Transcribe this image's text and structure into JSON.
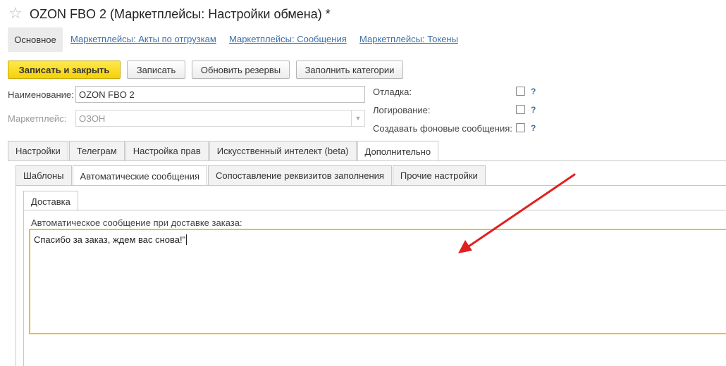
{
  "window": {
    "title": "OZON FBO 2 (Маркетплейсы: Настройки обмена) *",
    "star_icon": "☆"
  },
  "nav": {
    "active": "Основное",
    "links": [
      "Маркетплейсы: Акты по отгрузкам",
      "Маркетплейсы: Сообщения",
      "Маркетплейсы: Токены"
    ]
  },
  "toolbar": {
    "save_close": "Записать и закрыть",
    "save": "Записать",
    "refresh_reserves": "Обновить резервы",
    "fill_categories": "Заполнить категории"
  },
  "form": {
    "name_label": "Наименование:",
    "name_value": "OZON FBO 2",
    "marketplace_label": "Маркетплейс:",
    "marketplace_value": "ОЗОН",
    "debug_label": "Отладка:",
    "logging_label": "Логирование:",
    "bg_messages_label": "Создавать фоновые сообщения:",
    "help": "?"
  },
  "tabs_main": [
    "Настройки",
    "Телеграм",
    "Настройка прав",
    "Искусственный интелект (beta)",
    "Дополнительно"
  ],
  "tabs_sub": [
    "Шаблоны",
    "Автоматические сообщения",
    "Сопоставление реквизитов заполнения",
    "Прочие настройки"
  ],
  "tabs_inner": [
    "Доставка"
  ],
  "delivery": {
    "label": "Автоматическое сообщение при доставке заказа:",
    "message": "Спасибо за заказ, ждем вас снова!\""
  },
  "colors": {
    "accent": "#f5d10a",
    "link": "#3c6fa8",
    "arrow": "#e02020",
    "focus_border": "#f0c020"
  }
}
